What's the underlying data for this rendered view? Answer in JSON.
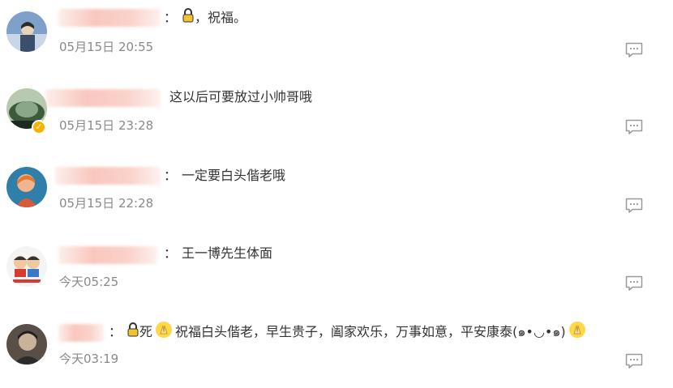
{
  "comments": [
    {
      "prefix": "：",
      "badge_icon": "lock-icon",
      "text": "，祝福。",
      "time": "05月15日 20:55",
      "avatar_colors": [
        "#6f8fb8",
        "#c9d6e8",
        "#3b4f6b"
      ]
    },
    {
      "prefix": "",
      "text": "这以后可要放过小帅哥哦",
      "time": "05月15日 23:28",
      "verified": true,
      "avatar_colors": [
        "#3e5a3c",
        "#b7c9b0",
        "#1d2a22"
      ]
    },
    {
      "prefix": "：",
      "text": "一定要白头偕老哦",
      "time": "05月15日 22:28",
      "avatar_colors": [
        "#d75a3b",
        "#f0b58f",
        "#2f7fa8"
      ]
    },
    {
      "prefix": "：",
      "text": "王一博先生体面",
      "time": "今天05:25",
      "avatar_colors": [
        "#f4f4f4",
        "#d63b2f",
        "#333333"
      ]
    },
    {
      "prefix": "：",
      "badge_icon": "lock-icon",
      "pre_text": "死",
      "emoji_icon": "praying-hands-emoji-icon",
      "text": "祝福白头偕老，早生贵子，阖家欢乐，万事如意，平安康泰(๑•◡•๑)",
      "time": "今天03:19",
      "avatar_colors": [
        "#2b2b2b",
        "#9a8f84",
        "#5a4f46"
      ]
    }
  ],
  "reply_icon": "comment-reply-icon",
  "colors": {
    "text": "#333333",
    "timestamp": "#8a8a8a",
    "icon": "#9a9a9a",
    "verified": "#f5b400"
  }
}
